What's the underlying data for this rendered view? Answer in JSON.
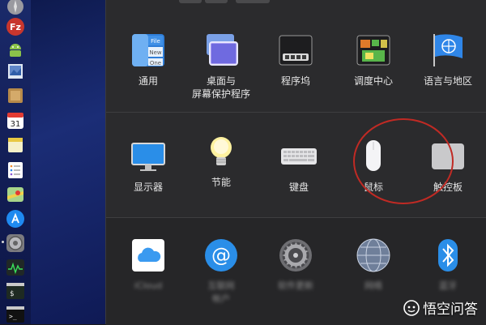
{
  "dock": {
    "items": [
      {
        "name": "launchpad-icon",
        "glyph": "✧"
      },
      {
        "name": "filezilla-icon",
        "glyph": "Fz"
      },
      {
        "name": "android-icon",
        "glyph": "🤖"
      },
      {
        "name": "preview-icon",
        "glyph": "✎"
      },
      {
        "name": "notes-icon",
        "glyph": "≡"
      },
      {
        "name": "calendar-icon",
        "glyph": "31"
      },
      {
        "name": "stickies-icon",
        "glyph": "▤"
      },
      {
        "name": "reminders-icon",
        "glyph": "☰"
      },
      {
        "name": "maps-icon",
        "glyph": "⌖"
      },
      {
        "name": "app-store-icon",
        "glyph": "A"
      },
      {
        "name": "system-preferences-icon",
        "glyph": "⚙"
      },
      {
        "name": "activity-monitor-icon",
        "glyph": "∿"
      },
      {
        "name": "console-icon",
        "glyph": "$"
      },
      {
        "name": "terminal-icon",
        "glyph": ">_"
      }
    ]
  },
  "preferences": {
    "row1": [
      {
        "id": "general",
        "label": "通用"
      },
      {
        "id": "desktop",
        "label": "桌面与\n屏幕保护程序"
      },
      {
        "id": "dock",
        "label": "程序坞"
      },
      {
        "id": "mission-control",
        "label": "调度中心"
      },
      {
        "id": "language-region",
        "label": "语言与地区"
      }
    ],
    "row2": [
      {
        "id": "displays",
        "label": "显示器"
      },
      {
        "id": "energy-saver",
        "label": "节能"
      },
      {
        "id": "keyboard",
        "label": "键盘"
      },
      {
        "id": "mouse",
        "label": "鼠标"
      },
      {
        "id": "trackpad",
        "label": "触控板"
      }
    ],
    "row3": [
      {
        "id": "icloud",
        "label": "iCloud"
      },
      {
        "id": "internet-accounts",
        "label": "互联网\n帐户"
      },
      {
        "id": "software-update",
        "label": "软件更新"
      },
      {
        "id": "network",
        "label": "网络"
      },
      {
        "id": "bluetooth",
        "label": "蓝牙"
      }
    ],
    "general_icon_text": {
      "file": "File",
      "new": "New",
      "one": "One"
    },
    "calendar_day": "31"
  },
  "watermark": {
    "text": "悟空问答"
  },
  "colors": {
    "highlight_circle": "#c02a24",
    "window_bg": "#2b2b2d",
    "dock_bg": "#14205a"
  }
}
